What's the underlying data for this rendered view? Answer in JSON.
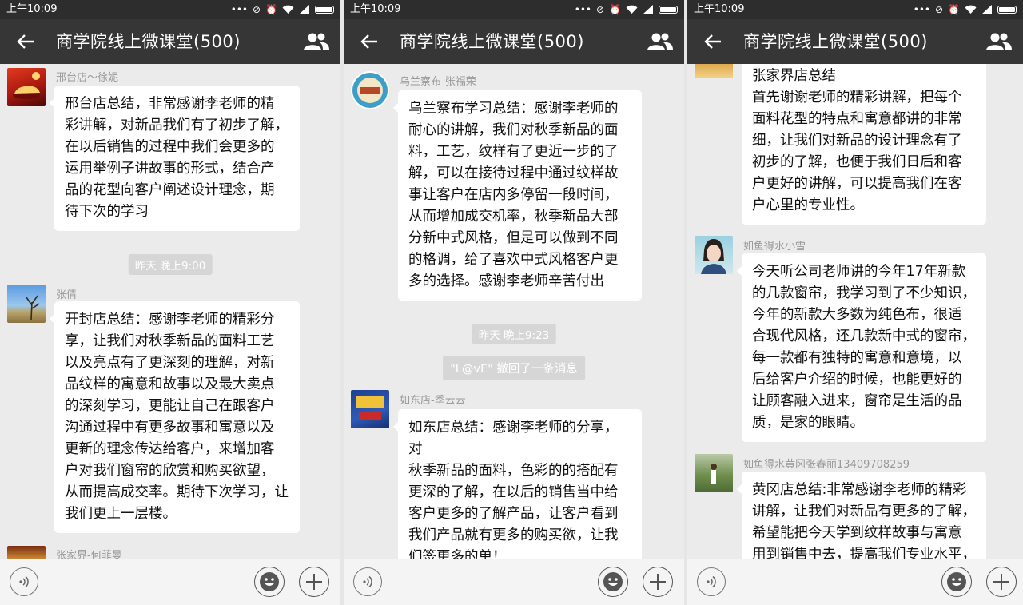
{
  "status_bar": {
    "time": "上午10:09",
    "dots": "•••"
  },
  "header": {
    "title": "商学院线上微课堂(500)"
  },
  "panels": [
    {
      "messages": [
        {
          "sender": "邢台店～徐妮",
          "avatar": "avatar-red-car",
          "text": "邢台店总结，非常感谢李老师的精\n彩讲解，对新品我们有了初步了解，\n在以后销售的过程中我们会更多的\n运用举例子讲故事的形式，结合产\n品的花型向客户阐述设计理念，期\n待下次的学习"
        },
        {
          "sender": "张倩",
          "avatar": "avatar-landscape-tree",
          "text": "开封店总结：感谢李老师的精彩分\n享，让我们对秋季新品的面料工艺\n以及亮点有了更深刻的理解，对新\n品纹样的寓意和故事以及最大卖点\n的深刻学习，更能让自己在跟客户\n沟通过程中有更多故事和寓意以及\n更新的理念传达给客户，来增加客\n户对我们窗帘的欣赏和购买欲望，\n从而提高成交率。期待下次学习，让\n我们更上一层楼。"
        },
        {
          "sender": "张家界-何菲曼",
          "avatar": "avatar-poster"
        }
      ],
      "timestamps": [
        "昨天 晚上9:00"
      ]
    },
    {
      "messages": [
        {
          "sender": "乌兰察布-张福荣",
          "avatar": "avatar-round-logo",
          "text": "乌兰察布学习总结：感谢李老师的\n耐心的讲解，我们对秋季新品的面\n料，工艺，纹样有了更近一步的了\n解，可以在接待过程中通过纹样故\n事让客户在店内多停留一段时间，\n从而增加成交机率，秋季新品大部\n分新中式风格，但是可以做到不同\n的格调，给了喜欢中式风格客户更\n多的选择。感谢李老师辛苦付出"
        },
        {
          "sender": "如东店-季云云",
          "avatar": "avatar-blue-poster",
          "text": "如东店总结：感谢李老师的分享，对\n秋季新品的面料，色彩的的搭配有\n更深的了解，在以后的销售当中给\n客户更多的了解产品，让客户看到\n我们产品就有更多的购买欲，让我\n们签更多的单！"
        }
      ],
      "timestamps": [
        "昨天 晚上9:23"
      ],
      "system": [
        "\"L@vE\" 撤回了一条消息"
      ]
    },
    {
      "messages": [
        {
          "sender": "",
          "avatar": "avatar-poster",
          "text": "张家界店总结\n首先谢谢老师的精彩讲解，把每个\n面料花型的特点和寓意都讲的非常\n细，让我们对新品的设计理念有了\n初步的了解，也便于我们日后和客\n户更好的讲解，可以提高我们在客\n户心里的专业性。"
        },
        {
          "sender": "如鱼得水小雪",
          "avatar": "avatar-portrait",
          "text": "今天听公司老师讲的今年17年新款\n的几款窗帘，我学习到了不少知识，\n今年的新款大多数为纯色布，很适\n合现代风格，还几款新中式的窗帘，\n每一款都有独特的寓意和意境，以\n后给客户介绍的时候，也能更好的\n让顾客融入进来，窗帘是生活的品\n质，是家的眼睛。"
        },
        {
          "sender": "如鱼得水黄冈张春丽13409708259",
          "avatar": "avatar-person-outdoor",
          "text": "黄冈店总结:非常感谢李老师的精彩\n讲解，让我们对新品有更多的了解，\n希望能把今天学到纹样故事与寓意\n用到销售中去，提高我们专业水平，"
        }
      ]
    }
  ],
  "icons": {
    "back": "back-arrow-icon",
    "group": "group-members-icon",
    "voice": "voice-input-icon",
    "emoji": "emoji-icon",
    "plus": "plus-icon"
  },
  "colors": {
    "title_bar": "#363636",
    "status_bar": "#2d2d2d",
    "chat_bg": "#ebebeb",
    "bubble": "#ffffff",
    "meta_text": "#999999"
  }
}
